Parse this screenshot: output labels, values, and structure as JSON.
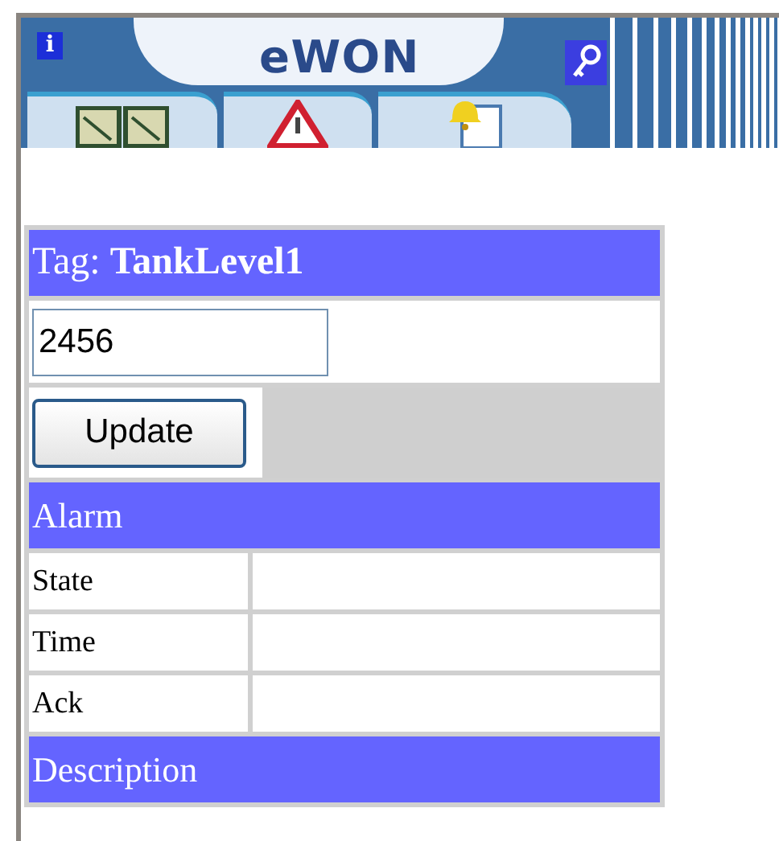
{
  "header": {
    "info_glyph": "i",
    "logo": "eWON"
  },
  "tag_title": "Tag: **TankLevel1**",
  "value_field": {
    "value": "2456"
  },
  "update_button": "Update",
  "alarm_section": {
    "title": "Alarm",
    "rows": [
      {
        "label": "State"
      },
      {
        "label": "Time"
      },
      {
        "label": "Ack"
      }
    ]
  },
  "description_section": {
    "title": "Description"
  }
}
